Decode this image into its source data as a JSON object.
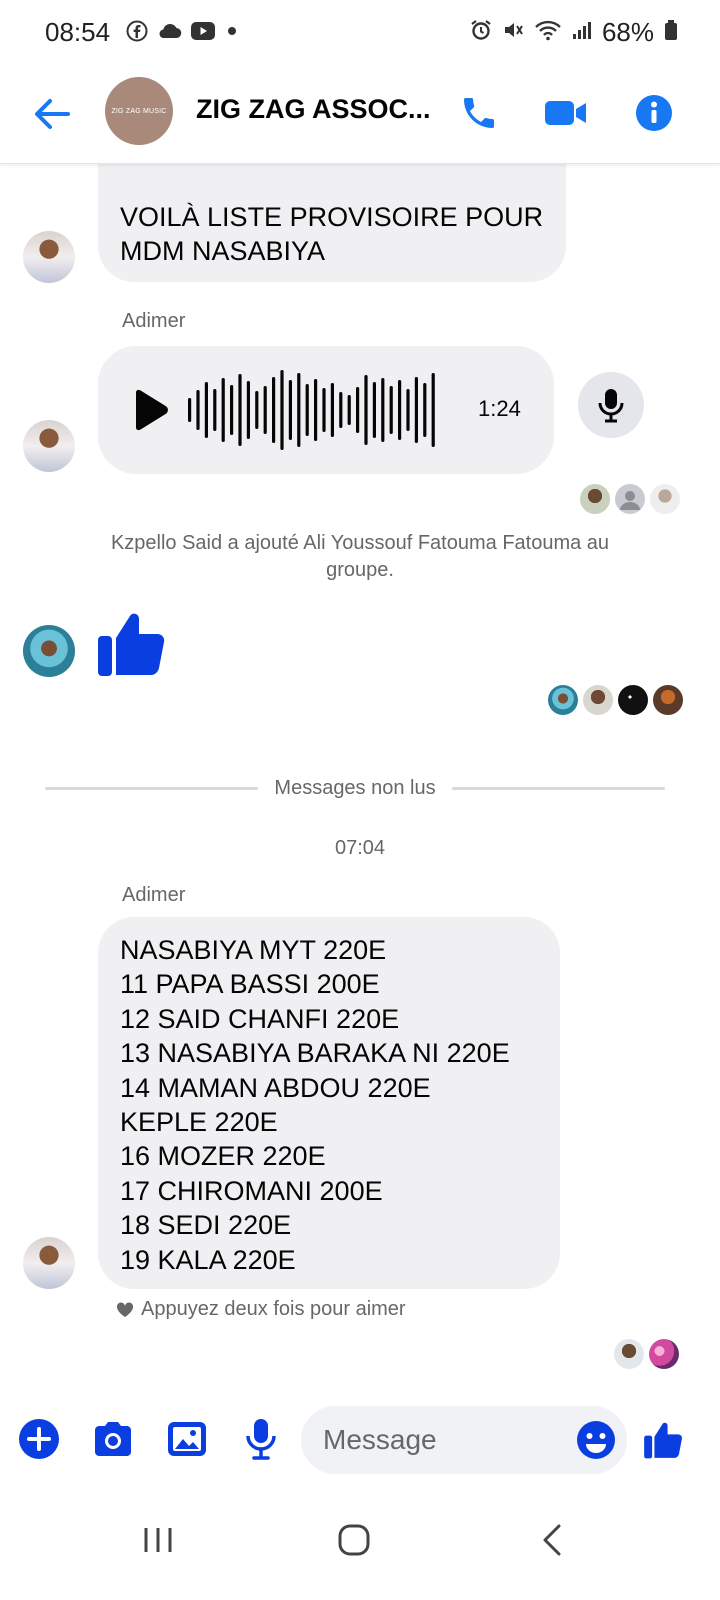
{
  "status_bar": {
    "time": "08:54",
    "battery": "68%",
    "left_icons": [
      "facebook-icon",
      "cloud-icon",
      "youtube-icon",
      "dot-icon"
    ],
    "right_icons": [
      "alarm-icon",
      "mute-icon",
      "wifi-icon",
      "signal-icon",
      "battery-icon"
    ]
  },
  "header": {
    "group_avatar_text": "ZIG ZAG MUSIC",
    "title": "ZIG ZAG ASSOC...",
    "accent_color": "#1877f2"
  },
  "conversation": {
    "messages": [
      {
        "type": "text",
        "sender": "",
        "lines": [
          "VOILÀ LISTE PROVISOIRE POUR",
          "MDM NASABIYA"
        ]
      },
      {
        "type": "voice",
        "sender": "Adimer",
        "duration": "1:24"
      },
      {
        "type": "system",
        "text": "Kzpello Said a ajouté Ali Youssouf Fatouma Fatouma au groupe."
      },
      {
        "type": "like",
        "sender": ""
      },
      {
        "type": "text",
        "sender": "Adimer",
        "lines": [
          "NASABIYA MYT 220E",
          "11 PAPA BASSI 200E",
          "12 SAID CHANFI 220E",
          "13 NASABIYA BARAKA NI 220E",
          "14 MAMAN ABDOU 220E",
          "KEPLE 220E",
          "16 MOZER 220E",
          "17 CHIROMANI 200E",
          "18 SEDI 220E",
          "19 KALA 220E"
        ]
      }
    ],
    "unread_divider": "Messages non lus",
    "timestamp": "07:04",
    "like_hint": "Appuyez deux fois pour aimer"
  },
  "composer": {
    "placeholder": "Message",
    "like_color": "#0a3ee0"
  },
  "navbar": {
    "buttons": [
      "recent-apps-icon",
      "home-icon",
      "back-nav-icon"
    ]
  }
}
